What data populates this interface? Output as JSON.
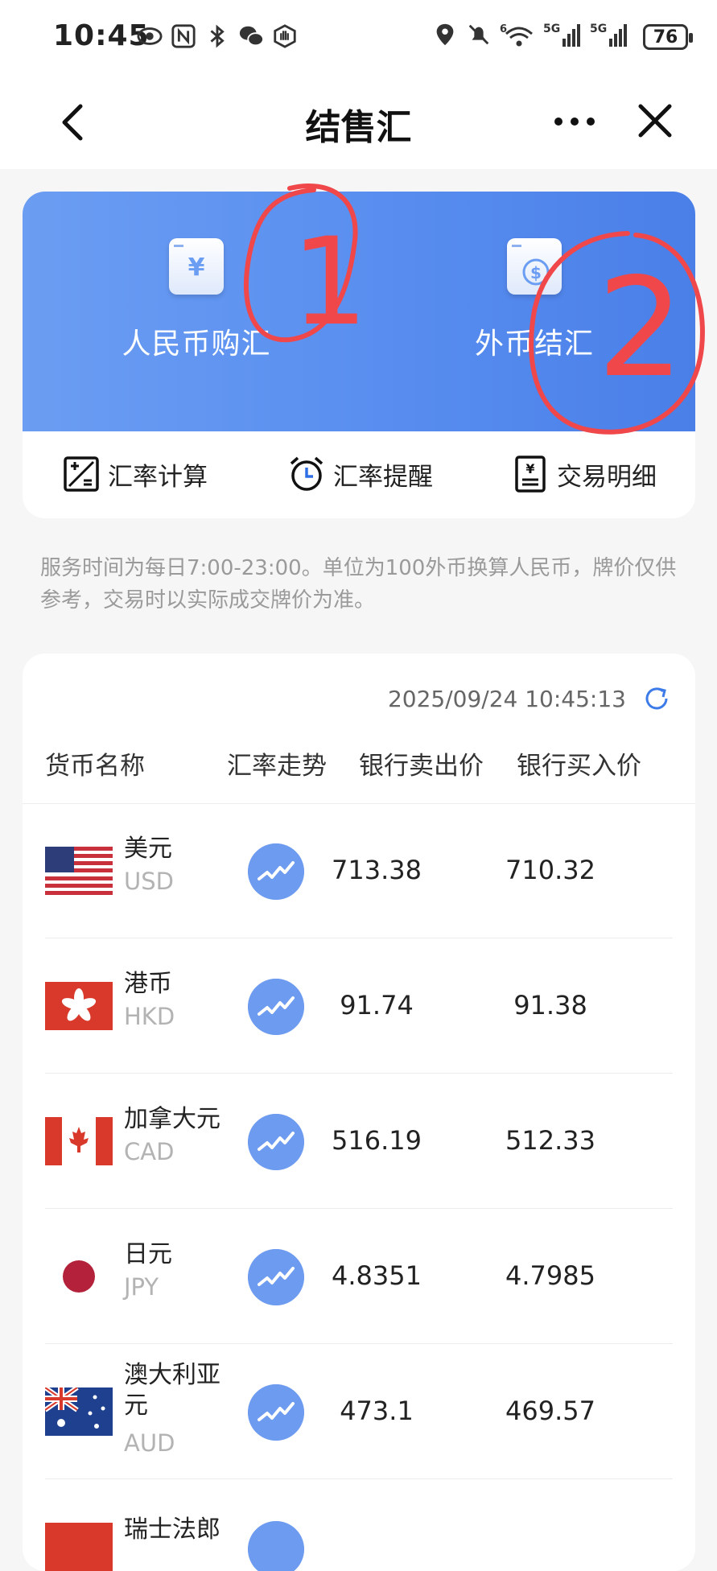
{
  "status_bar": {
    "time": "10:45",
    "network_1": "5G",
    "network_2": "5G",
    "wifi_label": "6",
    "battery": "76"
  },
  "nav": {
    "title": "结售汇"
  },
  "hero": {
    "rmb_label": "人民币购汇",
    "fx_label": "外币结汇",
    "rmb_icon_glyph": "¥",
    "fx_icon_glyph": "$",
    "annotation_1": "1",
    "annotation_2": "2"
  },
  "tools": [
    {
      "label": "汇率计算",
      "icon": "calculator-icon"
    },
    {
      "label": "汇率提醒",
      "icon": "alarm-clock-icon"
    },
    {
      "label": "交易明细",
      "icon": "receipt-icon"
    }
  ],
  "notice": "服务时间为每日7:00-23:00。单位为100外币换算人民币，牌价仅供参考，交易时以实际成交牌价为准。",
  "rates": {
    "timestamp": "2025/09/24 10:45:13",
    "headers": {
      "name": "货币名称",
      "trend": "汇率走势",
      "sell": "银行卖出价",
      "buy": "银行买入价"
    },
    "rows": [
      {
        "name": "美元",
        "code": "USD",
        "sell": "713.38",
        "buy": "710.32",
        "flag": "us-flag-icon"
      },
      {
        "name": "港币",
        "code": "HKD",
        "sell": "91.74",
        "buy": "91.38",
        "flag": "hk-flag-icon"
      },
      {
        "name": "加拿大元",
        "code": "CAD",
        "sell": "516.19",
        "buy": "512.33",
        "flag": "ca-flag-icon"
      },
      {
        "name": "日元",
        "code": "JPY",
        "sell": "4.8351",
        "buy": "4.7985",
        "flag": "jp-flag-icon"
      },
      {
        "name": "澳大利亚元",
        "code": "AUD",
        "sell": "473.1",
        "buy": "469.57",
        "flag": "au-flag-icon"
      },
      {
        "name": "瑞士法郎",
        "code": "",
        "sell": "",
        "buy": "",
        "flag": "ch-flag-icon"
      }
    ]
  },
  "colors": {
    "hero_start": "#6b9df2",
    "hero_end": "#4a7fe8",
    "trend_button": "#6d9bf0",
    "annotation": "#f0474b"
  }
}
